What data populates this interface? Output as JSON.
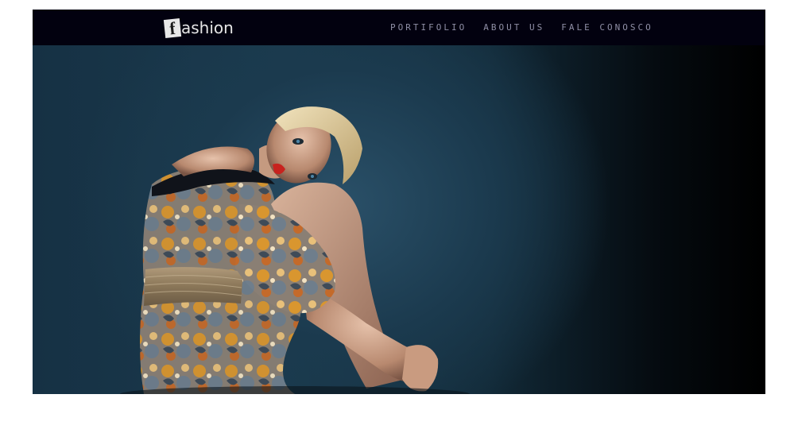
{
  "brand": {
    "badge_letter": "f",
    "name_rest": "ashion"
  },
  "nav": {
    "items": [
      {
        "label": "PORTIFOLIO"
      },
      {
        "label": "ABOUT US"
      },
      {
        "label": "FALE CONOSCO"
      }
    ]
  },
  "hero": {
    "image": "fashion-model-photo",
    "colors": {
      "background_light": "#2a5068",
      "background_dark": "#000000",
      "topbar": "#02010f"
    }
  }
}
